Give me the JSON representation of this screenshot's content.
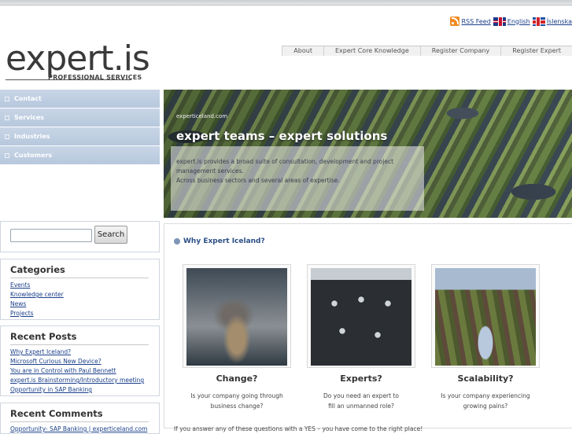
{
  "lang_bar": {
    "rss_label": "RSS Feed",
    "english_label": "English",
    "icelandic_label": "Íslenska"
  },
  "logo": {
    "main": "expert",
    "dot": ".",
    "tld": "is",
    "tagline": "PROFESSIONAL SERVICES"
  },
  "top_nav": [
    "About",
    "Expert Core Knowledge",
    "Register Company",
    "Register Expert"
  ],
  "side_nav": [
    "Contact",
    "Services",
    "Industries",
    "Customers"
  ],
  "hero": {
    "site": "experticeland.com",
    "title": "expert teams – expert solutions",
    "line1": "expert.is provides a broad suite of consultation, development and project management services.",
    "line2": "Across business sectors and several areas of expertise."
  },
  "search": {
    "placeholder": "",
    "button_label": "Search"
  },
  "categories": {
    "title": "Categories",
    "items": [
      "Events",
      "Knowledge center",
      "News",
      "Projects"
    ]
  },
  "recent_posts": {
    "title": "Recent Posts",
    "items": [
      "Why Expert Iceland?",
      "Microsoft Curious New Device?",
      "You are in Control with Paul Bennett",
      "expert.is Brainstorming/Introductory meeting",
      "Opportunity in SAP Banking"
    ]
  },
  "recent_comments": {
    "title": "Recent Comments",
    "items": [
      "Opportunity- SAP Banking | experticeland.com"
    ]
  },
  "main": {
    "heading": "Why Expert Iceland?",
    "cards": [
      {
        "title": "Change?",
        "desc1": "Is your company going through",
        "desc2": "business change?"
      },
      {
        "title": "Experts?",
        "desc1": "Do you need an expert to",
        "desc2": "fill an unmanned role?"
      },
      {
        "title": "Scalability?",
        "desc1": "Is your company experiencing",
        "desc2": "growing pains?"
      }
    ],
    "footer_text": "If you answer any of these questions with a YES – you have come to the right place!"
  },
  "colors": {
    "nav_blue": "#b7c8dd",
    "link_blue": "#1a3f8a",
    "heading_blue": "#2c4f86"
  }
}
